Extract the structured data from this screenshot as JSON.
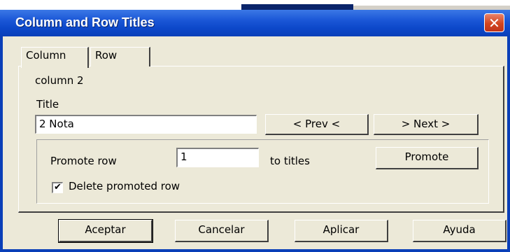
{
  "window": {
    "title": "Column and Row Titles",
    "close_glyph": "✕"
  },
  "tabs": [
    {
      "label": "Column"
    },
    {
      "label": "Row"
    }
  ],
  "panel": {
    "subtitle": "column 2",
    "title_label": "Title",
    "title_value": "2 Nota",
    "prev_label": "< Prev <",
    "next_label": "> Next >"
  },
  "promote": {
    "row_label": "Promote row",
    "row_value": "1",
    "to_titles_label": "to titles",
    "button_label": "Promote",
    "delete_checked": true,
    "check_glyph": "✔",
    "delete_label": "Delete promoted row"
  },
  "footer": {
    "ok_label": "Aceptar",
    "cancel_label": "Cancelar",
    "apply_label": "Aplicar",
    "help_label": "Ayuda"
  },
  "colors": {
    "titlebar": "#0c47c9",
    "face": "#ece9d8",
    "close": "#d2451f"
  }
}
